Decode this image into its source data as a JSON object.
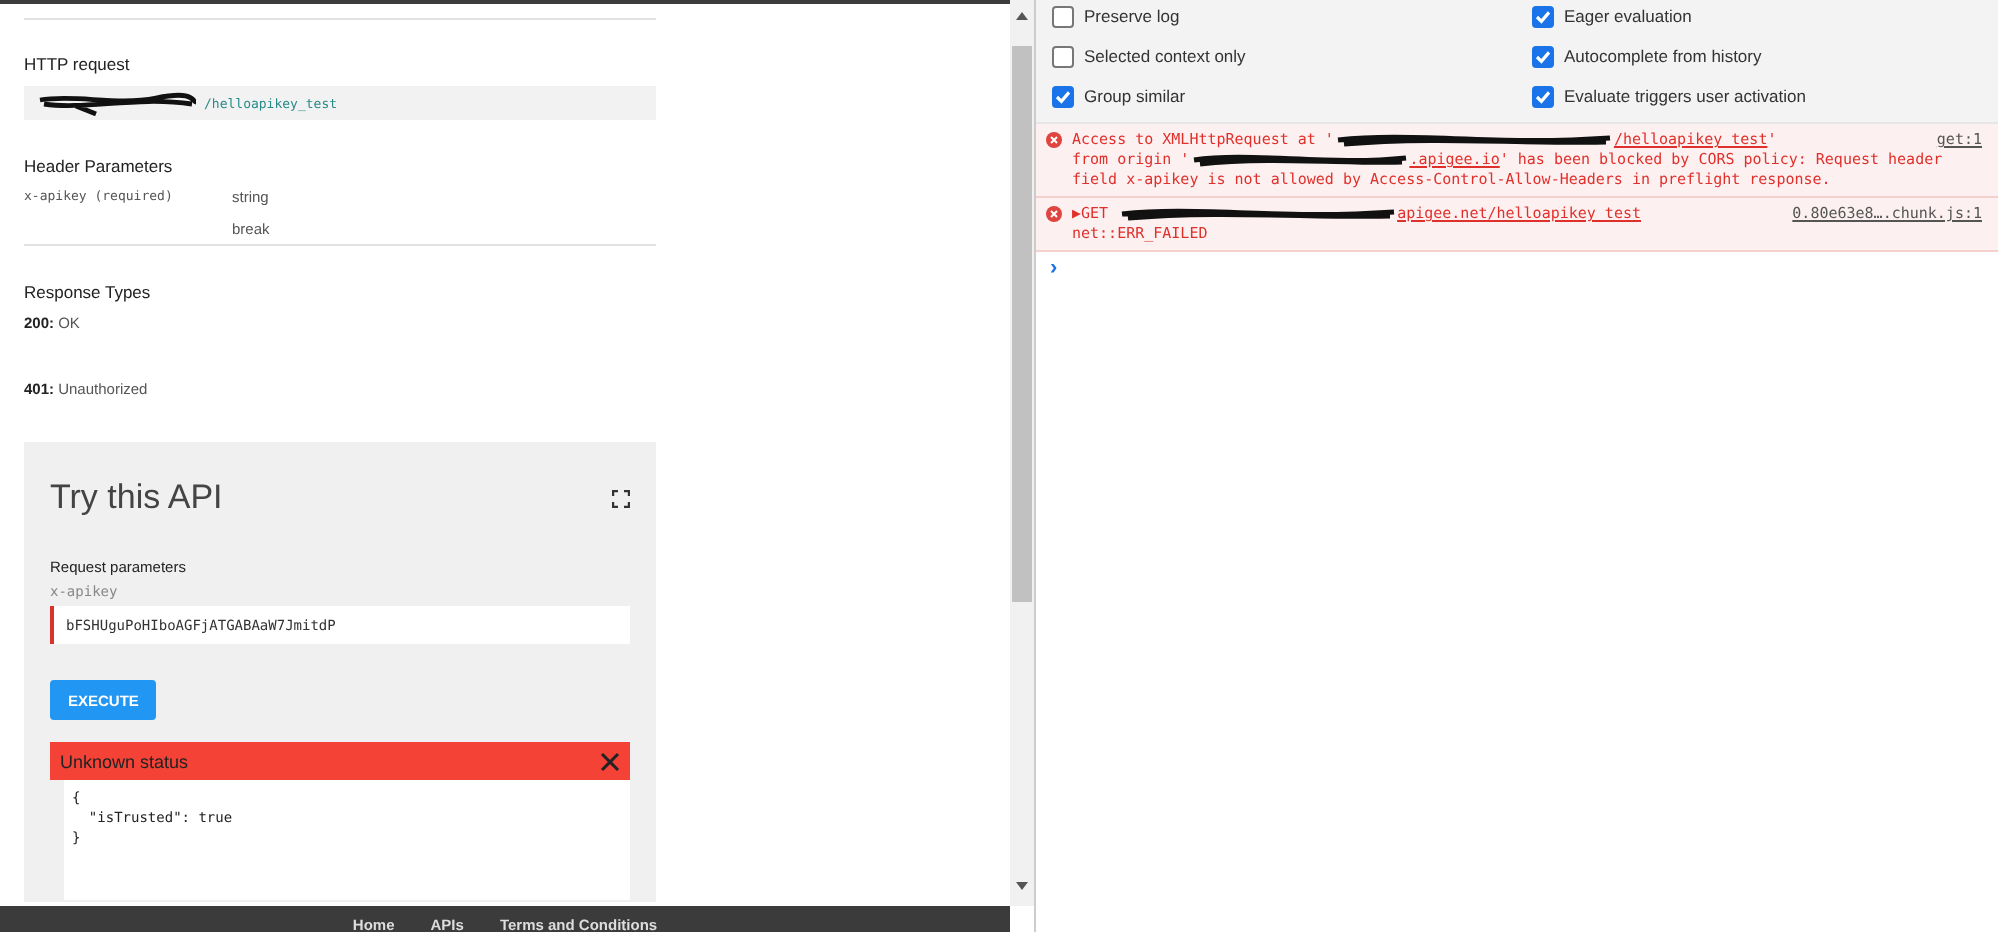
{
  "docs": {
    "http_request": {
      "heading": "HTTP request",
      "path": "/helloapikey_test"
    },
    "header_parameters": {
      "heading": "Header Parameters",
      "rows": [
        {
          "name": "x-apikey (required)",
          "type": "string",
          "format": "break"
        }
      ]
    },
    "response_types": {
      "heading": "Response Types",
      "items": [
        {
          "code": "200:",
          "label": "OK"
        },
        {
          "code": "401:",
          "label": "Unauthorized"
        }
      ]
    },
    "try_api": {
      "title": "Try this API",
      "section": "Request parameters",
      "field_label": "x-apikey",
      "field_value": "bFSHUguPoHIboAGFjATGABAaW7JmitdP",
      "button": "EXECUTE",
      "result_title": "Unknown status",
      "result_lines": [
        "{",
        "  \"isTrusted\": true",
        "}"
      ]
    },
    "footer_links": [
      "Home",
      "APIs",
      "Terms and Conditions"
    ]
  },
  "console": {
    "settings": [
      {
        "label": "Preserve log",
        "checked": false
      },
      {
        "label": "Eager evaluation",
        "checked": true
      },
      {
        "label": "Selected context only",
        "checked": false
      },
      {
        "label": "Autocomplete from history",
        "checked": true
      },
      {
        "label": "Group similar",
        "checked": true
      },
      {
        "label": "Evaluate triggers user activation",
        "checked": true
      }
    ],
    "messages": [
      {
        "parts": [
          {
            "kind": "text",
            "text": "Access to XMLHttpRequest at '"
          },
          {
            "kind": "redacted"
          },
          {
            "kind": "link",
            "text": "/helloapikey_test"
          },
          {
            "kind": "text",
            "text": "'"
          }
        ],
        "source": "get:1",
        "continuation": [
          {
            "kind": "text",
            "text": "from origin '"
          },
          {
            "kind": "redacted"
          },
          {
            "kind": "link",
            "text": ".apigee.io"
          },
          {
            "kind": "text",
            "text": "' has been blocked by CORS policy: Request header field x-apikey is not allowed by Access-Control-Allow-Headers in preflight response."
          }
        ]
      },
      {
        "parts": [
          {
            "kind": "text",
            "text": "▶GET "
          },
          {
            "kind": "redacted"
          },
          {
            "kind": "link",
            "text": "apigee.net/helloapikey_test"
          }
        ],
        "source": "0.80e63e8….chunk.js:1",
        "continuation": [
          {
            "kind": "text",
            "text": "net::ERR_FAILED"
          }
        ]
      }
    ],
    "prompt": "›"
  }
}
